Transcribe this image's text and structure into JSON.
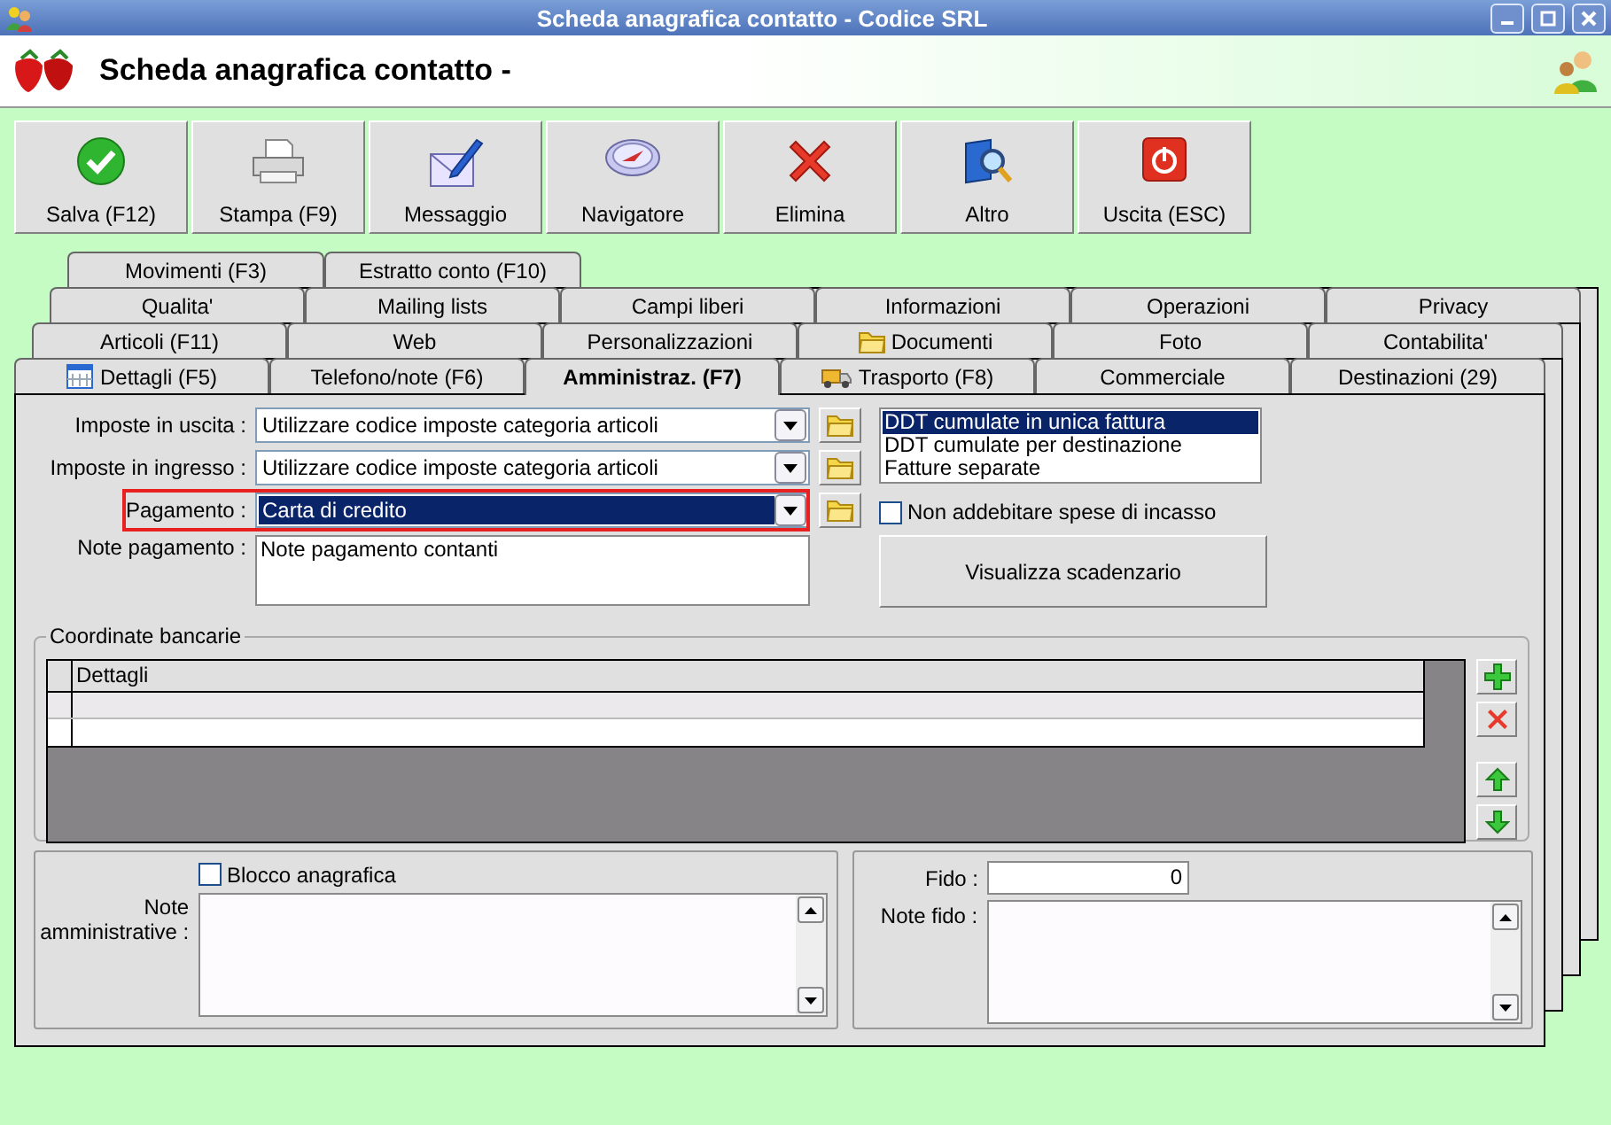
{
  "window": {
    "title": "Scheda anagrafica contatto - Codice SRL"
  },
  "header": {
    "title": "Scheda anagrafica contatto -"
  },
  "toolbar": [
    {
      "label": "Salva (F12)",
      "kind": "save"
    },
    {
      "label": "Stampa (F9)",
      "kind": "print"
    },
    {
      "label": "Messaggio",
      "kind": "message"
    },
    {
      "label": "Navigatore",
      "kind": "navigator"
    },
    {
      "label": "Elimina",
      "kind": "delete"
    },
    {
      "label": "Altro",
      "kind": "other"
    },
    {
      "label": "Uscita (ESC)",
      "kind": "exit"
    }
  ],
  "tab_rows": [
    [
      {
        "label": "Movimenti (F3)",
        "selected": false,
        "kind": "plain"
      },
      {
        "label": "Estratto conto (F10)",
        "selected": false,
        "kind": "plain"
      }
    ],
    [
      {
        "label": "Qualita'",
        "selected": false,
        "kind": "plain"
      },
      {
        "label": "Mailing lists",
        "selected": false,
        "kind": "plain"
      },
      {
        "label": "Campi liberi",
        "selected": false,
        "kind": "plain"
      },
      {
        "label": "Informazioni",
        "selected": false,
        "kind": "plain"
      },
      {
        "label": "Operazioni",
        "selected": false,
        "kind": "plain"
      },
      {
        "label": "Privacy",
        "selected": false,
        "kind": "plain"
      }
    ],
    [
      {
        "label": "Articoli (F11)",
        "selected": false,
        "kind": "plain"
      },
      {
        "label": "Web",
        "selected": false,
        "kind": "plain"
      },
      {
        "label": "Personalizzazioni",
        "selected": false,
        "kind": "plain"
      },
      {
        "label": "Documenti",
        "selected": false,
        "kind": "folder"
      },
      {
        "label": "Foto",
        "selected": false,
        "kind": "plain"
      },
      {
        "label": "Contabilita'",
        "selected": false,
        "kind": "plain"
      }
    ],
    [
      {
        "label": "Dettagli (F5)",
        "selected": false,
        "kind": "calendar"
      },
      {
        "label": "Telefono/note (F6)",
        "selected": false,
        "kind": "plain"
      },
      {
        "label": "Amministraz. (F7)",
        "selected": true,
        "kind": "plain"
      },
      {
        "label": "Trasporto (F8)",
        "selected": false,
        "kind": "truck"
      },
      {
        "label": "Commerciale",
        "selected": false,
        "kind": "plain"
      },
      {
        "label": "Destinazioni (29)",
        "selected": false,
        "kind": "plain"
      }
    ]
  ],
  "fields": [
    {
      "label": "Imposte in uscita :",
      "value": "Utilizzare codice imposte categoria articoli",
      "focused": false,
      "highlighted": false
    },
    {
      "label": "Imposte in ingresso :",
      "value": "Utilizzare codice imposte categoria articoli",
      "focused": false,
      "highlighted": false
    },
    {
      "label": "Pagamento :",
      "value": "Carta di credito",
      "focused": true,
      "highlighted": true
    }
  ],
  "payment_notes": {
    "label": "Note pagamento :",
    "value": "Note pagamento contanti"
  },
  "invoice_modes": [
    {
      "label": "DDT cumulate in unica fattura",
      "selected": true
    },
    {
      "label": "DDT cumulate per destinazione",
      "selected": false
    },
    {
      "label": "Fatture separate",
      "selected": false
    }
  ],
  "no_collection_fees": {
    "label": "Non addebitare spese di incasso",
    "checked": false
  },
  "schedule_button": "Visualizza scadenzario",
  "bank": {
    "title": "Coordinate bancarie",
    "columns": [
      "Dettagli"
    ]
  },
  "admin": {
    "block": {
      "label": "Blocco anagrafica",
      "checked": false
    },
    "notes_label": "Note amministrative :"
  },
  "credit": {
    "label": "Fido :",
    "value": "0",
    "notes_label": "Note fido :"
  }
}
